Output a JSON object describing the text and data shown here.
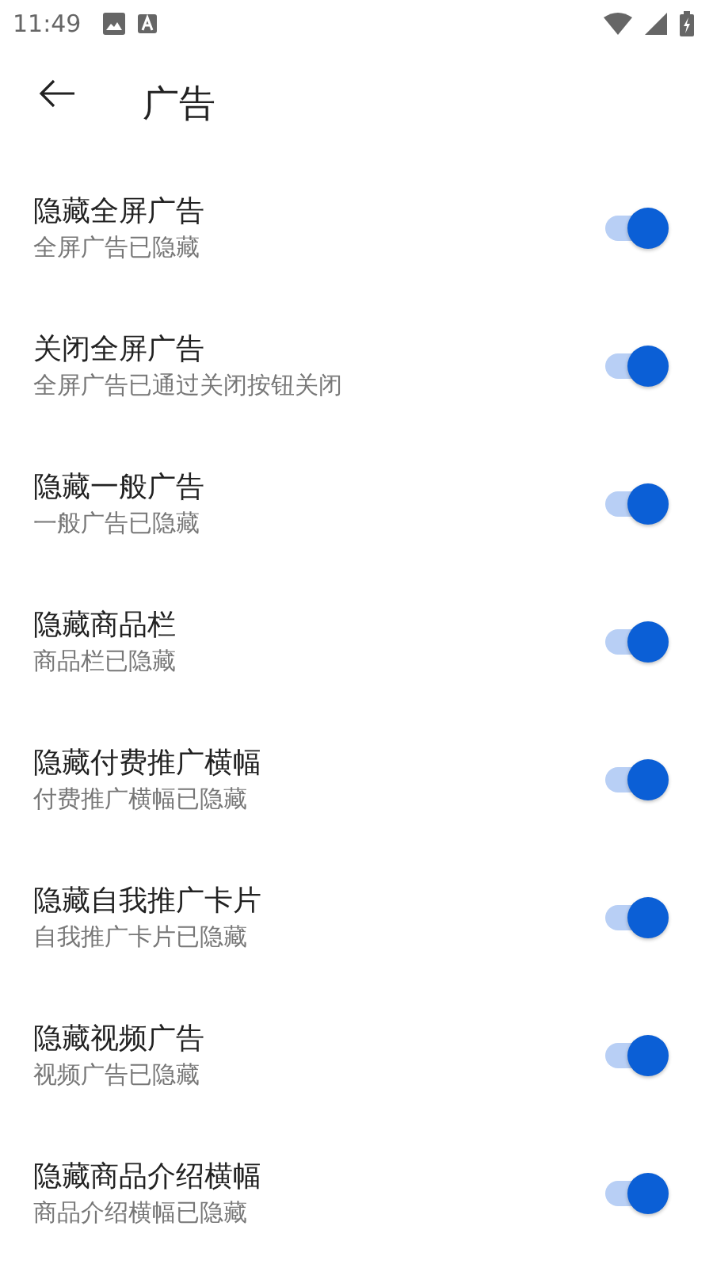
{
  "status_bar": {
    "time": "11:49"
  },
  "header": {
    "title": "广告"
  },
  "settings": [
    {
      "title": "隐藏全屏广告",
      "subtitle": "全屏广告已隐藏",
      "on": true
    },
    {
      "title": "关闭全屏广告",
      "subtitle": "全屏广告已通过关闭按钮关闭",
      "on": true
    },
    {
      "title": "隐藏一般广告",
      "subtitle": "一般广告已隐藏",
      "on": true
    },
    {
      "title": "隐藏商品栏",
      "subtitle": "商品栏已隐藏",
      "on": true
    },
    {
      "title": "隐藏付费推广横幅",
      "subtitle": "付费推广横幅已隐藏",
      "on": true
    },
    {
      "title": "隐藏自我推广卡片",
      "subtitle": "自我推广卡片已隐藏",
      "on": true
    },
    {
      "title": "隐藏视频广告",
      "subtitle": "视频广告已隐藏",
      "on": true
    },
    {
      "title": "隐藏商品介绍横幅",
      "subtitle": "商品介绍横幅已隐藏",
      "on": true
    }
  ]
}
